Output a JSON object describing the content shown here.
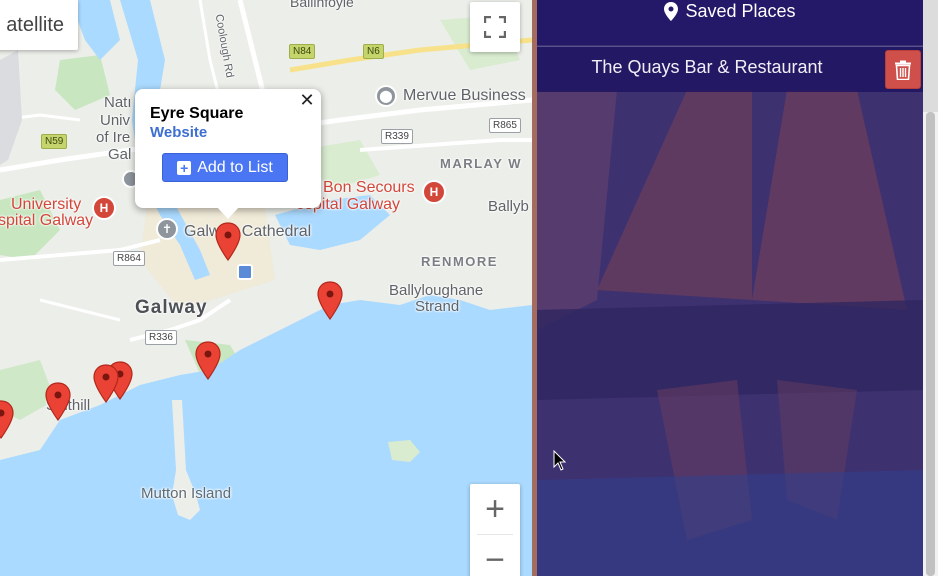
{
  "map": {
    "satellite_label": "atellite",
    "labels": {
      "ballinfoyle": "Ballinfoyle",
      "coolough_rd": "Coolough Rd",
      "mervue": "Mervue Business",
      "nat_univ_1": "Natı",
      "nat_univ_2": "Univ",
      "nat_univ_3": "of Ire",
      "nat_univ_4": "Gal",
      "marlay": "MARLAY W",
      "bon_secours_1": "Bon Secours",
      "bon_secours_2": "ospital Galway",
      "ballyb": "Ballyb",
      "university_1": "University",
      "university_2": "spital Galway",
      "cathedral": "Galway Cathedral",
      "galway": "Galway",
      "renmore": "RENMORE",
      "ballyloughane_1": "Ballyloughane",
      "ballyloughane_2": "Strand",
      "salthill": "Salthill",
      "mutton": "Mutton Island"
    },
    "roads": {
      "n84": "N84",
      "n6": "N6",
      "n59": "N59",
      "r339": "R339",
      "r865": "R865",
      "r864": "R864",
      "r336": "R336"
    },
    "hospital_glyph": "H",
    "zoom_in": "+",
    "zoom_out": "−",
    "info_window": {
      "title": "Eyre Square",
      "link": "Website",
      "close": "✕",
      "add_button": "Add to List"
    }
  },
  "panel": {
    "header": "Saved Places",
    "places": [
      {
        "name": "The Quays Bar & Restaurant"
      }
    ]
  },
  "colors": {
    "water": "#aadaff",
    "land": "#eceee9",
    "park": "#c8e6c0",
    "marker": "#ea4335",
    "panel_header": "#241868",
    "delete": "#cf4f4b",
    "accent": "#4a76f4"
  }
}
